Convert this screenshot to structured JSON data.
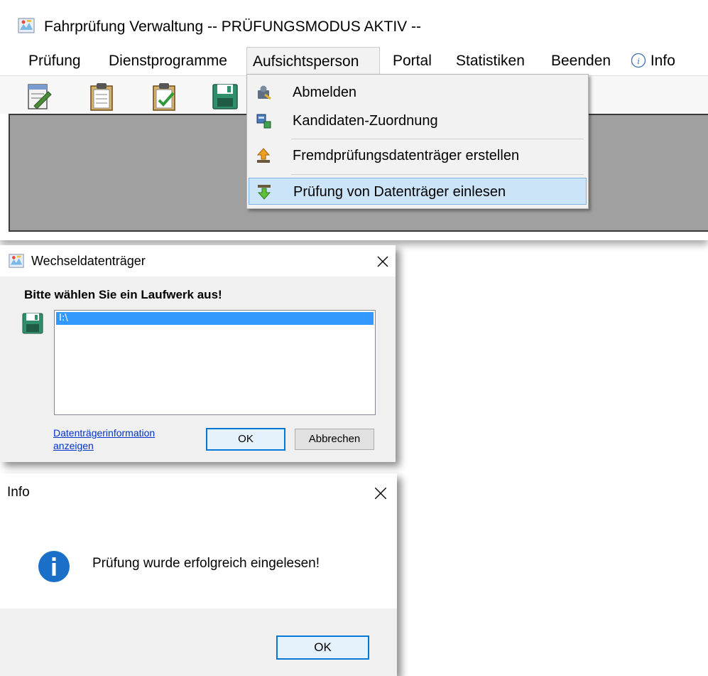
{
  "main": {
    "title": "Fahrprüfung Verwaltung -- PRÜFUNGSMODUS AKTIV --",
    "menu": {
      "pruefung": "Prüfung",
      "dienstprogramme": "Dienstprogramme",
      "aufsichtsperson": "Aufsichtsperson",
      "portal": "Portal",
      "statistiken": "Statistiken",
      "beenden": "Beenden",
      "info": "Info"
    },
    "toolbar_icons": [
      "edit-document-icon",
      "clipboard-icon",
      "clipboard-check-icon",
      "save-icon"
    ]
  },
  "dropdown": {
    "items": [
      {
        "label": "Abmelden",
        "icon": "logout-icon"
      },
      {
        "label": "Kandidaten-Zuordnung",
        "icon": "assign-icon"
      },
      {
        "label": "Fremdprüfungsdatenträger erstellen",
        "icon": "upload-arrow-icon"
      },
      {
        "label": "Prüfung von Datenträger einlesen",
        "icon": "import-arrow-icon"
      }
    ]
  },
  "drive_dialog": {
    "title": "Wechseldatenträger",
    "prompt": "Bitte wählen Sie ein Laufwerk aus!",
    "drives": [
      "I:\\"
    ],
    "link_line1": "Datenträgerinformation",
    "link_line2": "anzeigen",
    "ok": "OK",
    "cancel": "Abbrechen"
  },
  "info_dialog": {
    "title": "Info",
    "message": "Prüfung wurde erfolgreich eingelesen!",
    "ok": "OK"
  },
  "colors": {
    "selection": "#3399ff",
    "menu_hover": "#cce4f7",
    "info_blue": "#1a6fc9",
    "link": "#0033cc"
  }
}
